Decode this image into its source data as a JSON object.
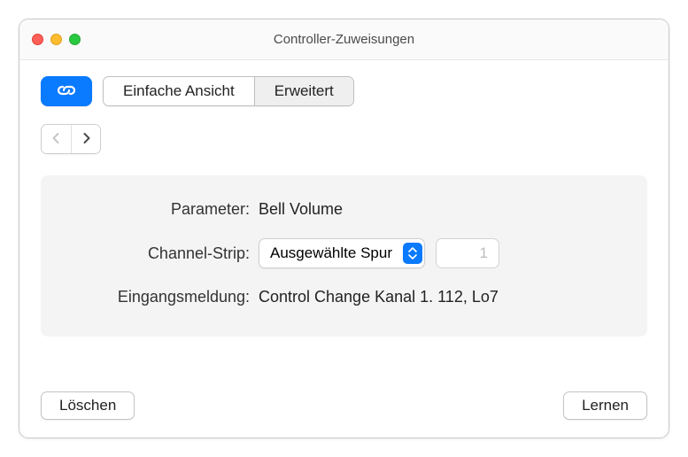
{
  "window": {
    "title": "Controller-Zuweisungen"
  },
  "toolbar": {
    "easy_label": "Einfache Ansicht",
    "expert_label": "Erweitert"
  },
  "panel": {
    "parameter_label": "Parameter:",
    "parameter_value": "Bell Volume",
    "channel_strip_label": "Channel-Strip:",
    "channel_strip_select": "Ausgewählte Spur",
    "channel_strip_number": "1",
    "input_msg_label": "Eingangsmeldung:",
    "input_msg_value": "Control Change Kanal 1. 112, Lo7"
  },
  "footer": {
    "delete_label": "Löschen",
    "learn_label": "Lernen"
  }
}
